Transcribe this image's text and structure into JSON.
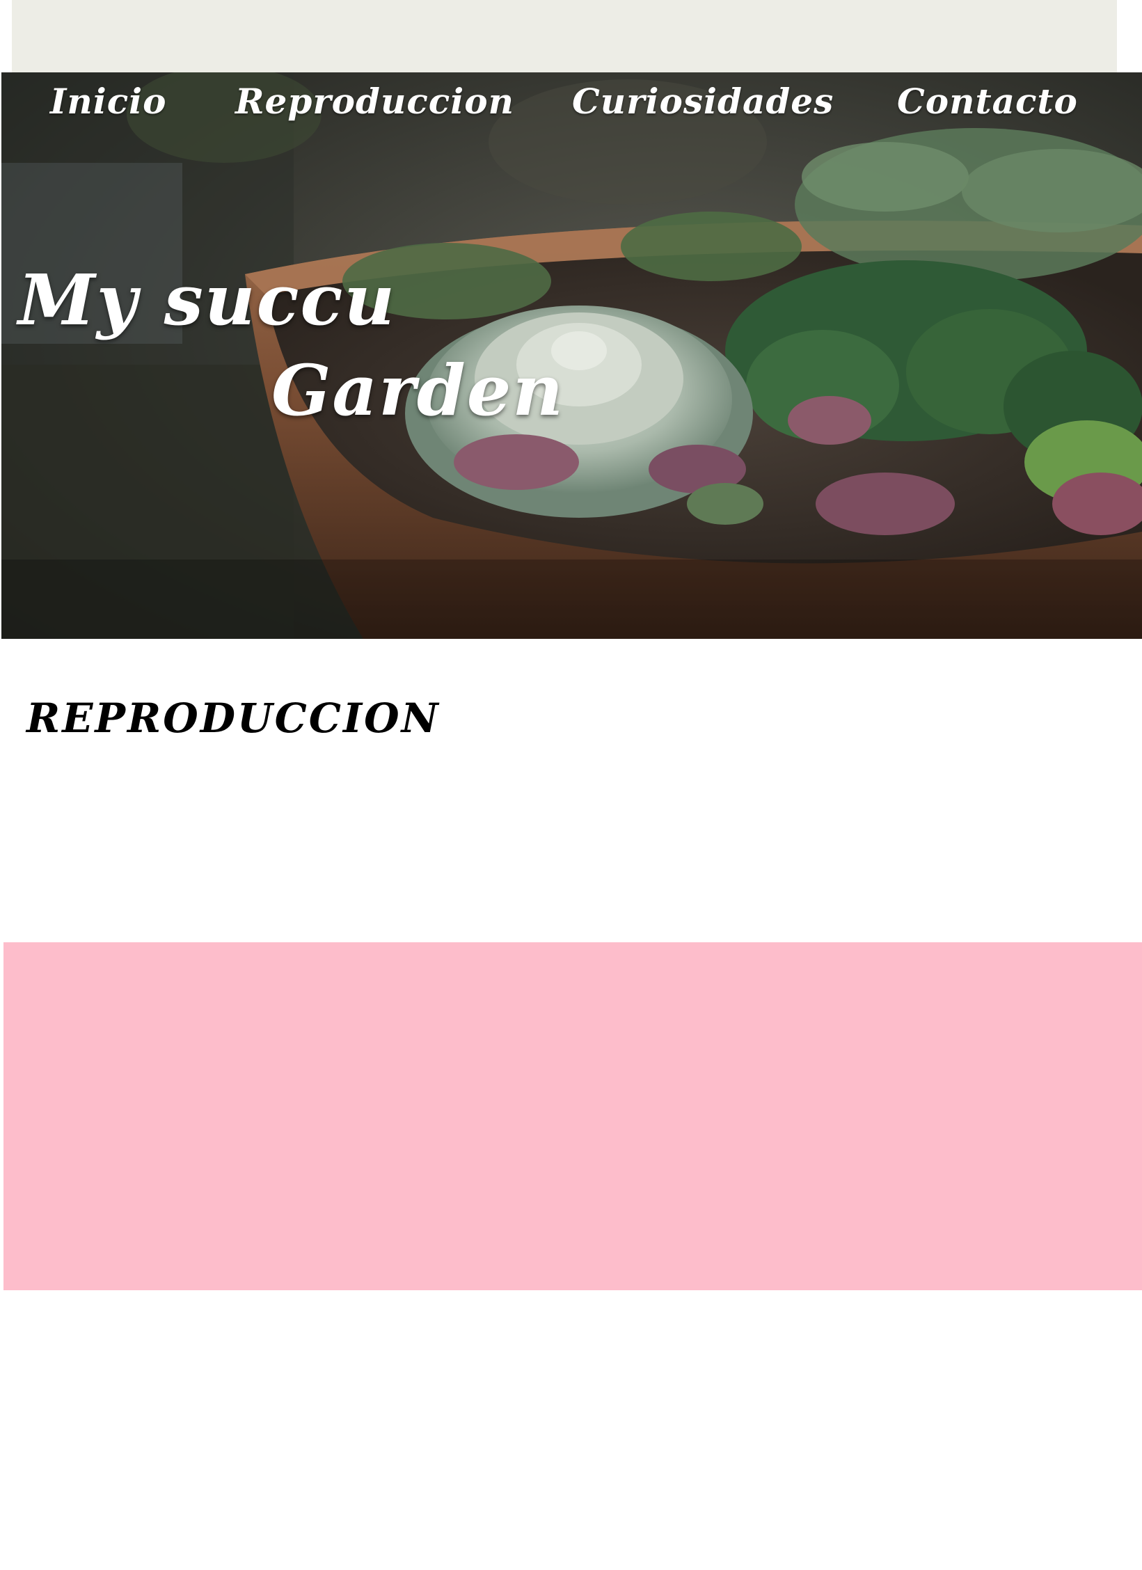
{
  "nav": {
    "items": [
      {
        "label": "Inicio"
      },
      {
        "label": "Reproduccion"
      },
      {
        "label": "Curiosidades"
      },
      {
        "label": "Contacto"
      }
    ]
  },
  "hero": {
    "title_line1": "My succu",
    "title_line2": "Garden",
    "image_subject": "succulent plants in a terracotta pot"
  },
  "main": {
    "section_title": "REPRODUCCION"
  },
  "colors": {
    "top_strip": "#edede6",
    "pink_band": "#fdbdcb",
    "nav_text": "#ffffff",
    "heading_text": "#000000"
  }
}
